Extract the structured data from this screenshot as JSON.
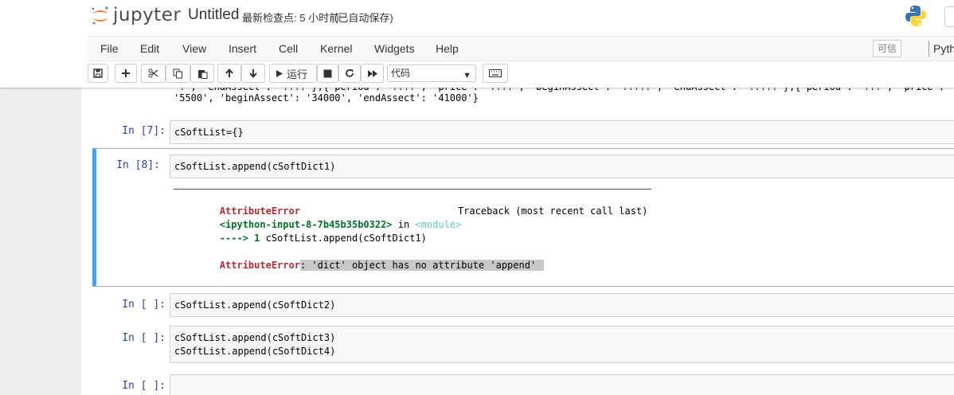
{
  "header": {
    "logo_text": "jupyter",
    "notebook_name": "Untitled",
    "checkpoint": "最新检查点: 5 小时前",
    "autosave": "(已自动保存)"
  },
  "menu": {
    "items": [
      "File",
      "Edit",
      "View",
      "Insert",
      "Cell",
      "Kernel",
      "Widgets",
      "Help"
    ],
    "trusted": "可信",
    "kernel": "Pyth"
  },
  "toolbar": {
    "run_label": "运行",
    "cell_type": "代码"
  },
  "cells": {
    "c0": {
      "output_line1": "'?', 'endAssect': '????'},{'period': '????', 'price': '????', 'beginAssect': '?????', 'endAssect': '?????'},{'period': '???', 'price':",
      "output_line2": "'5500', 'beginAssect': '34000', 'endAssect': '41000'}"
    },
    "c7": {
      "prompt": "In  [7]:",
      "code": "cSoftList={}"
    },
    "c8": {
      "prompt": "In  [8]:",
      "code": "cSoftList.append(cSoftDict1)",
      "rule": "---------------------------------------------------------------------------",
      "err_name": "AttributeError",
      "traceback": "Traceback (most recent call last)",
      "input_ref": "<ipython-input-8-7b45b35b0322>",
      "in_word": " in ",
      "module": "<module>",
      "arrow": "----> 1 ",
      "arrow_code": "cSoftList.append(cSoftDict1)",
      "err_name2": "AttributeError",
      "err_msg": ": 'dict' object has no attribute 'append'"
    },
    "c9": {
      "prompt": "In  [ ]:",
      "code": "cSoftList.append(cSoftDict2)"
    },
    "c10": {
      "prompt": "In  [ ]:",
      "code_line1": "cSoftList.append(cSoftDict3)",
      "code_line2": "cSoftList.append(cSoftDict4)"
    },
    "c11": {
      "prompt": "In  [ ]:"
    }
  },
  "colors": {
    "prompt": "#303f9f",
    "error": "#b22b31",
    "selected_border": "#42a5f5"
  }
}
